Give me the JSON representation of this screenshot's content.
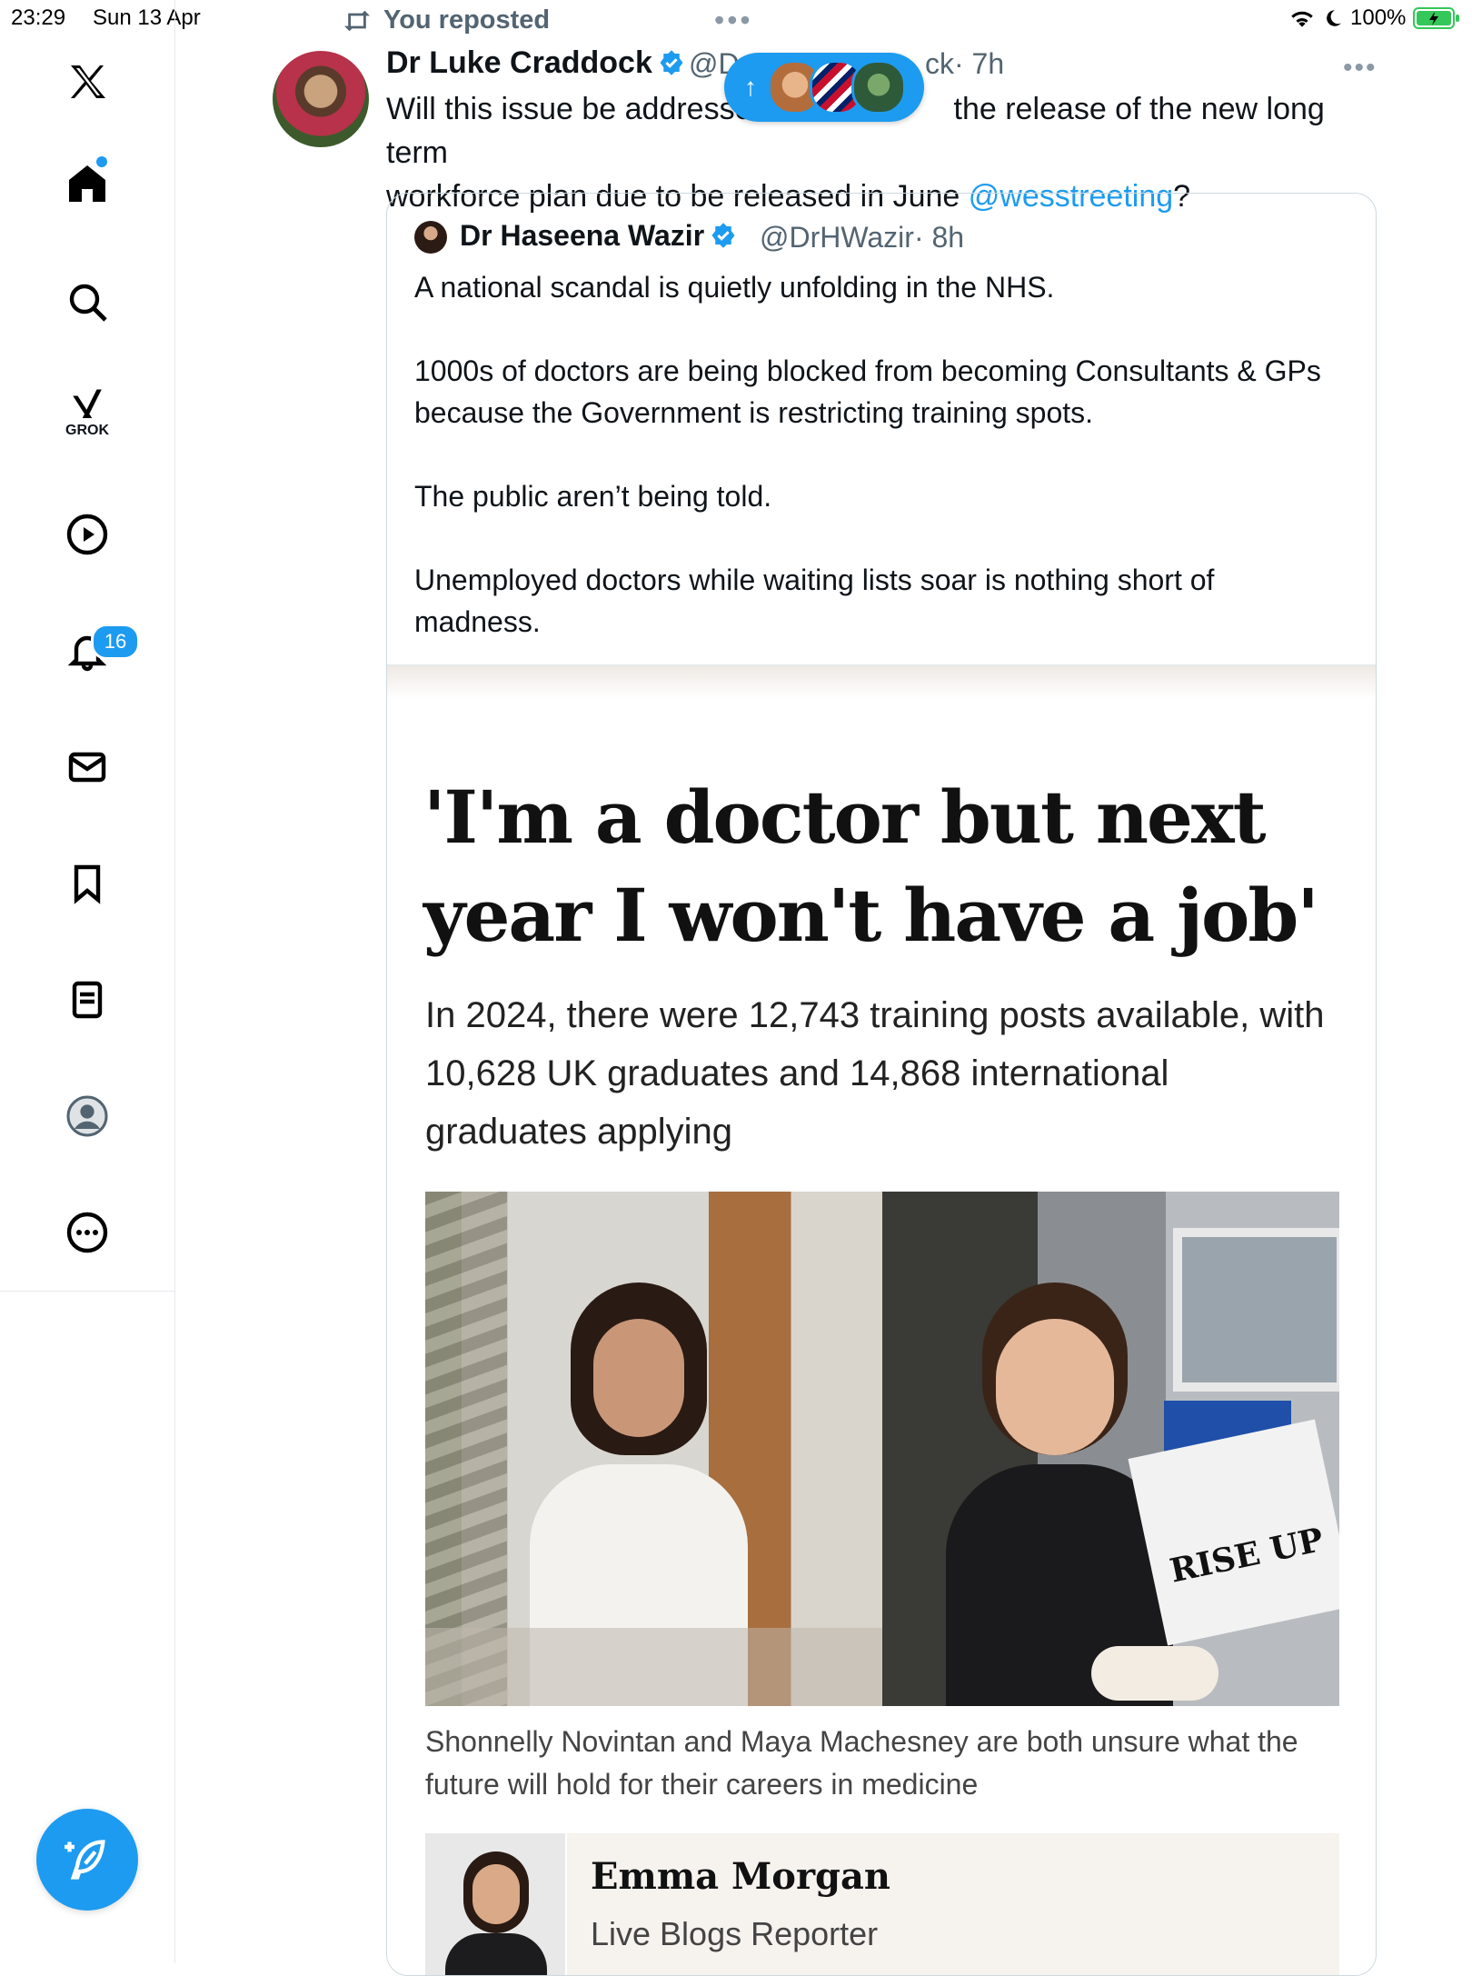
{
  "status_bar": {
    "time": "23:29",
    "date": "Sun 13 Apr",
    "battery": "100%"
  },
  "sidebar": {
    "items": [
      {
        "name": "x-logo-icon"
      },
      {
        "name": "home-icon"
      },
      {
        "name": "search-icon"
      },
      {
        "name": "grok-icon",
        "label": "GROK"
      },
      {
        "name": "play-icon"
      },
      {
        "name": "bell-icon",
        "badge": "16"
      },
      {
        "name": "mail-icon"
      },
      {
        "name": "bookmark-icon"
      },
      {
        "name": "list-icon"
      },
      {
        "name": "profile-icon"
      },
      {
        "name": "more-circle-icon"
      }
    ],
    "accent": "#1d9bf0"
  },
  "tweet": {
    "repost_label": "You reposted",
    "author_name": "Dr Luke Craddock",
    "handle_visible": "@D",
    "handle_tail": "ck",
    "time": "· 7h",
    "text_part1": "Will this issue be addresse",
    "text_part2": "the release of the new long term",
    "text_line2": "workforce plan due to be released in June ",
    "mention": "@wesstreeting",
    "text_end": "?"
  },
  "new_posts_pill": {
    "arrow": "↑"
  },
  "quote": {
    "author_name": "Dr Haseena Wazir",
    "handle": "@DrHWazir",
    "time": "· 8h",
    "text": "A national scandal is quietly unfolding in the NHS.\n\n1000s of doctors are being blocked from becoming Consultants & GPs because the Government is restricting training spots.\n\nThe public aren’t being told.\n\nUnemployed doctors while waiting lists soar is nothing short of madness.",
    "article": {
      "headline": "'I'm a doctor but next year I won't have a job'",
      "subhead": "In 2024, there were 12,743 training posts available, with 10,628 UK graduates and 14,868 international graduates applying",
      "caption": "Shonnelly Novintan and Maya Machesney are both unsure what the future will hold for their careers in medicine",
      "magazine_text": "RISE UP",
      "byline_name": "Emma Morgan",
      "byline_role": "Live Blogs Reporter"
    }
  }
}
